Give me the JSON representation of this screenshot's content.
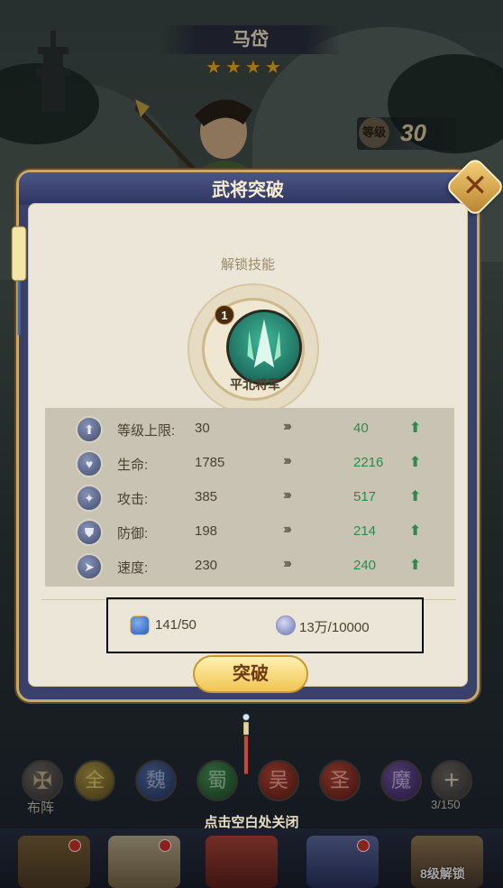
{
  "hero": {
    "name": "马岱",
    "stars": [
      "★",
      "★",
      "★",
      "★"
    ],
    "level_label": "等级",
    "level_value": "30"
  },
  "dialog": {
    "title": "武将突破",
    "close_symbol": "✕",
    "unlock_label": "解锁技能",
    "skill": {
      "badge": "1",
      "name": "平北将军"
    },
    "stats": [
      {
        "icon": "level-cap-icon",
        "glyph": "⬆",
        "name": "等级上限:",
        "old": "30",
        "arrow": "›››",
        "new": "40",
        "up": "⬆"
      },
      {
        "icon": "hp-icon",
        "glyph": "♥",
        "name": "生命:",
        "old": "1785",
        "arrow": "›››",
        "new": "2216",
        "up": "⬆"
      },
      {
        "icon": "attack-icon",
        "glyph": "✦",
        "name": "攻击:",
        "old": "385",
        "arrow": "›››",
        "new": "517",
        "up": "⬆"
      },
      {
        "icon": "defense-icon",
        "glyph": "⛊",
        "name": "防御:",
        "old": "198",
        "arrow": "›››",
        "new": "214",
        "up": "⬆"
      },
      {
        "icon": "speed-icon",
        "glyph": "➤",
        "name": "速度:",
        "old": "230",
        "arrow": "›››",
        "new": "240",
        "up": "⬆"
      }
    ],
    "cost": {
      "item1": "141/50",
      "item2": "13万/10000"
    },
    "break_button": "突破"
  },
  "bottom": {
    "formation_label": "布阵",
    "factions": [
      "全",
      "魏",
      "蜀",
      "吴",
      "圣",
      "魔"
    ],
    "count": "3/150",
    "close_hint": "点击空白处关闭",
    "unlock_tag": "8级解锁"
  },
  "colors": {
    "accent_gold": "#c9a96a",
    "stat_increase_green": "#2f8a4a",
    "dialog_frame": "#3a4168"
  }
}
